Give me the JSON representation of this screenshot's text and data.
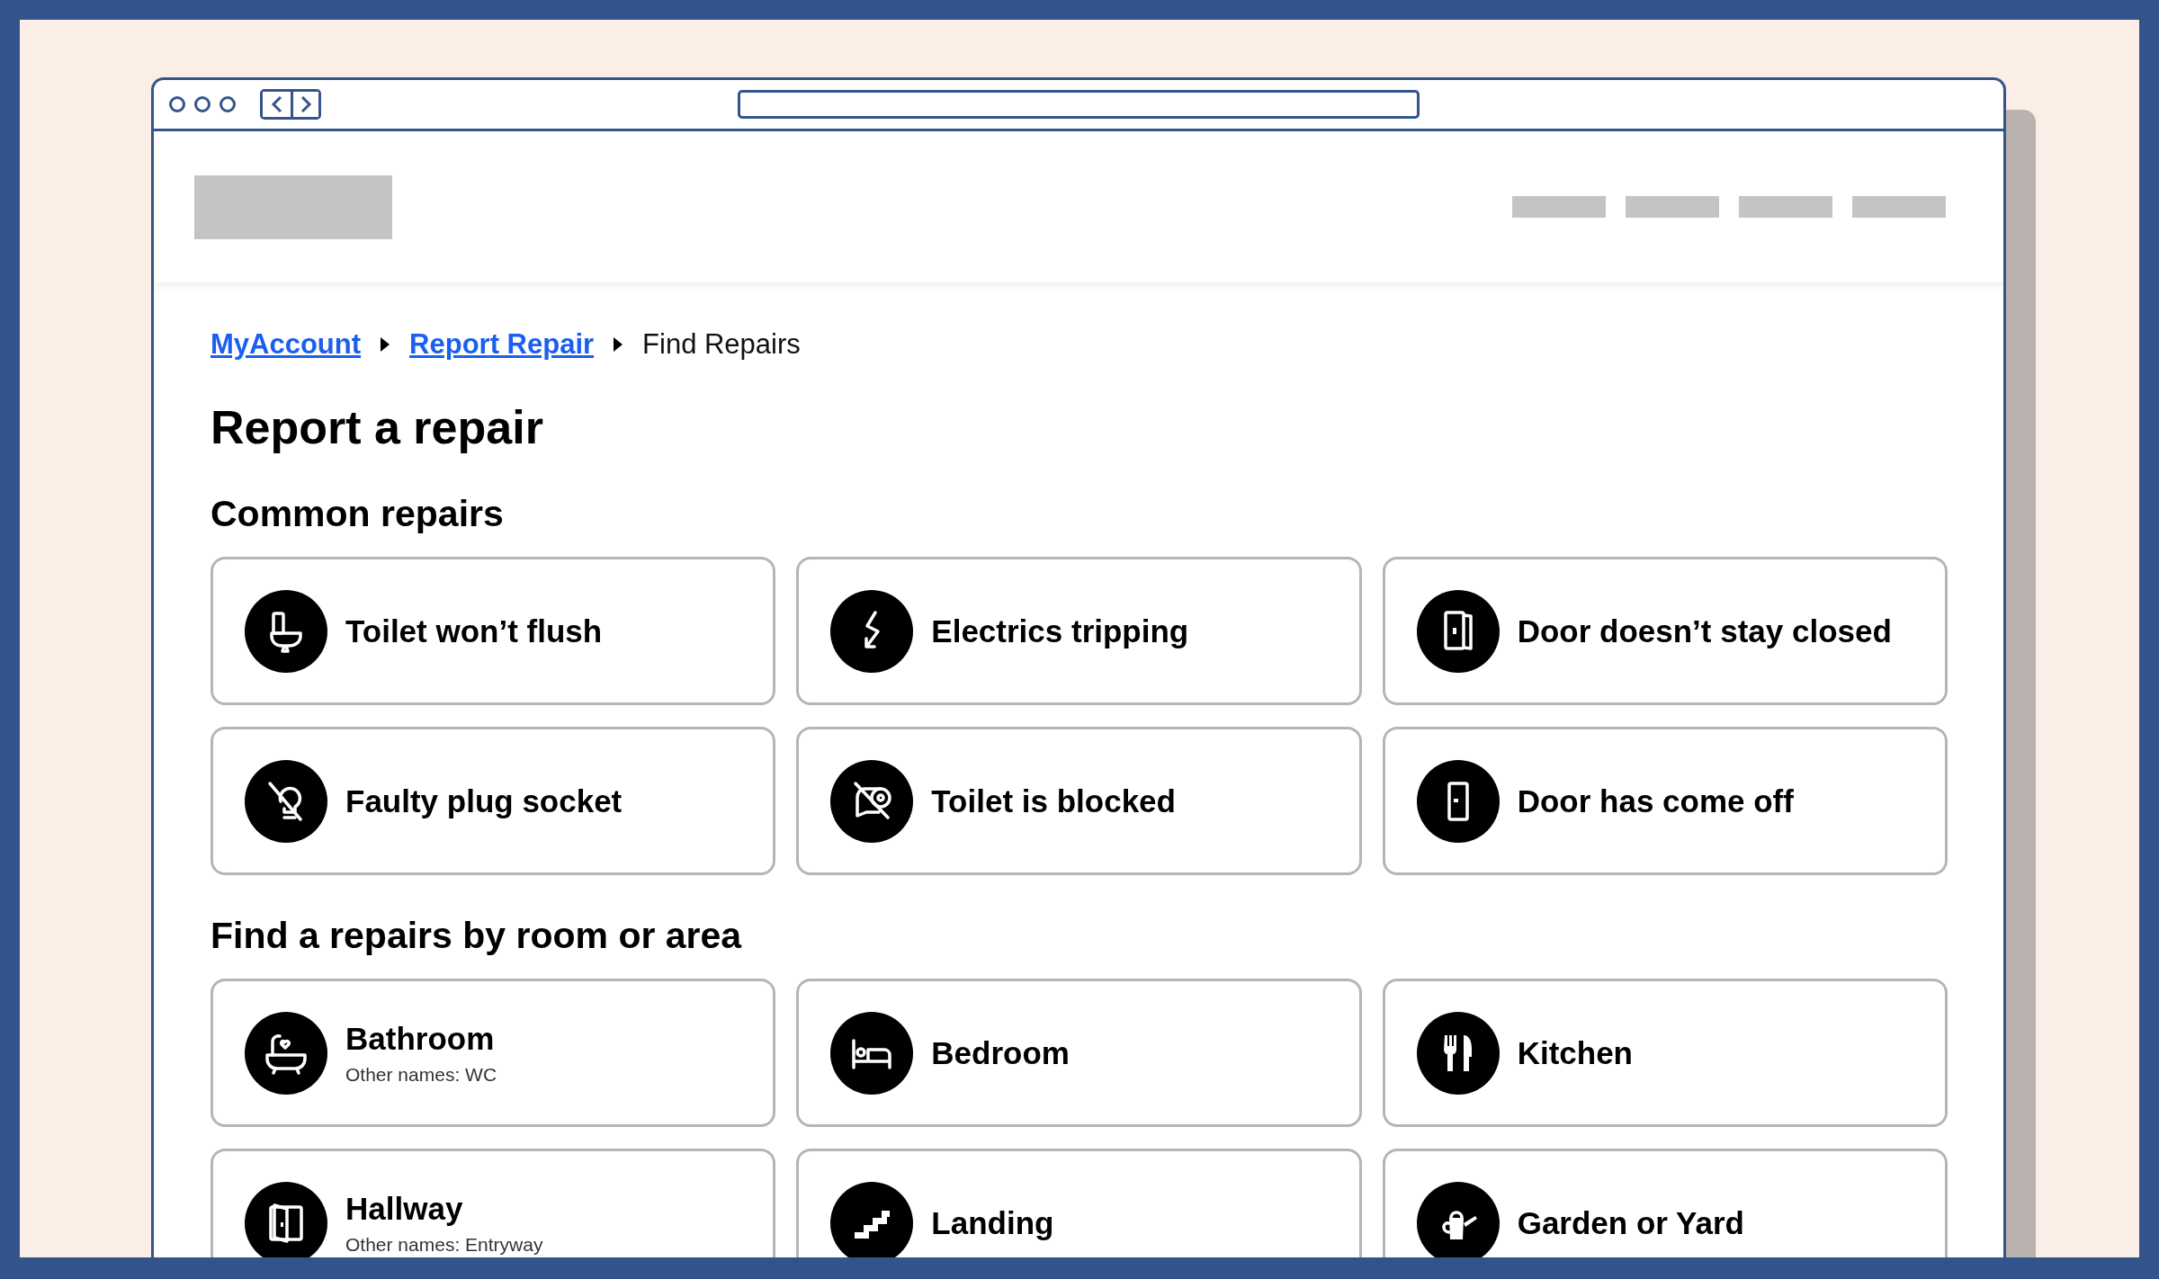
{
  "breadcrumb": [
    {
      "label": "MyAccount",
      "kind": "link"
    },
    {
      "label": "Report Repair",
      "kind": "link"
    },
    {
      "label": "Find Repairs",
      "kind": "current"
    }
  ],
  "title": "Report a repair",
  "sections": [
    {
      "heading": "Common repairs",
      "cards": [
        {
          "title": "Toilet won’t flush"
        },
        {
          "title": "Electrics tripping"
        },
        {
          "title": "Door doesn’t stay closed"
        },
        {
          "title": "Faulty plug socket"
        },
        {
          "title": "Toilet is blocked"
        },
        {
          "title": "Door has come off"
        }
      ]
    },
    {
      "heading": "Find a repairs by room or area",
      "cards": [
        {
          "title": "Bathroom",
          "subtitle": "Other names: WC"
        },
        {
          "title": "Bedroom"
        },
        {
          "title": "Kitchen"
        },
        {
          "title": "Hallway",
          "subtitle": "Other names: Entryway"
        },
        {
          "title": "Landing"
        },
        {
          "title": "Garden or Yard"
        }
      ]
    }
  ]
}
